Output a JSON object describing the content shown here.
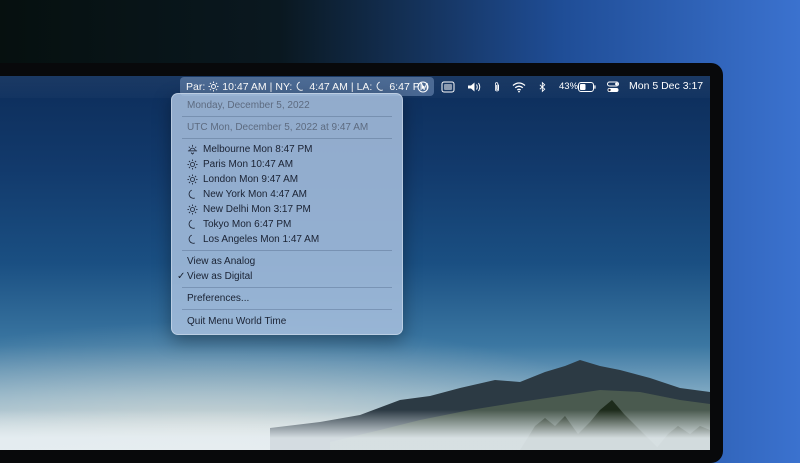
{
  "menubar": {
    "world_time_label": {
      "par": "Par:",
      "par_time": "10:47 AM",
      "sep1": "|",
      "ny": "NY:",
      "ny_time": "4:47 AM",
      "sep2": "|",
      "la": "LA:",
      "la_time": "6:47 PM"
    },
    "battery": "43%",
    "clock": "Mon 5 Dec  3:17"
  },
  "menu": {
    "date_line": "Monday, December 5, 2022",
    "utc_line": "UTC Mon, December 5, 2022 at 9:47 AM",
    "cities": [
      {
        "label": "Melbourne Mon 8:47 PM",
        "icon": "sunset-icon"
      },
      {
        "label": "Paris Mon 10:47 AM",
        "icon": "sun-icon"
      },
      {
        "label": "London Mon 9:47 AM",
        "icon": "sun-icon"
      },
      {
        "label": "New York Mon 4:47 AM",
        "icon": "moon-icon"
      },
      {
        "label": "New Delhi Mon 3:17 PM",
        "icon": "sun-icon"
      },
      {
        "label": "Tokyo Mon 6:47 PM",
        "icon": "moon-icon"
      },
      {
        "label": "Los Angeles Mon 1:47 AM",
        "icon": "moon-icon"
      }
    ],
    "view_analog": "View as Analog",
    "view_digital": "View as Digital",
    "check_mark": "✓",
    "preferences": "Preferences...",
    "quit": "Quit Menu World Time"
  },
  "icons": {
    "menubar": [
      "play-icon",
      "window-icon",
      "volume-icon",
      "paperclip-icon",
      "wifi-icon",
      "bluetooth-icon",
      "battery-icon",
      "control-center-icon"
    ]
  }
}
